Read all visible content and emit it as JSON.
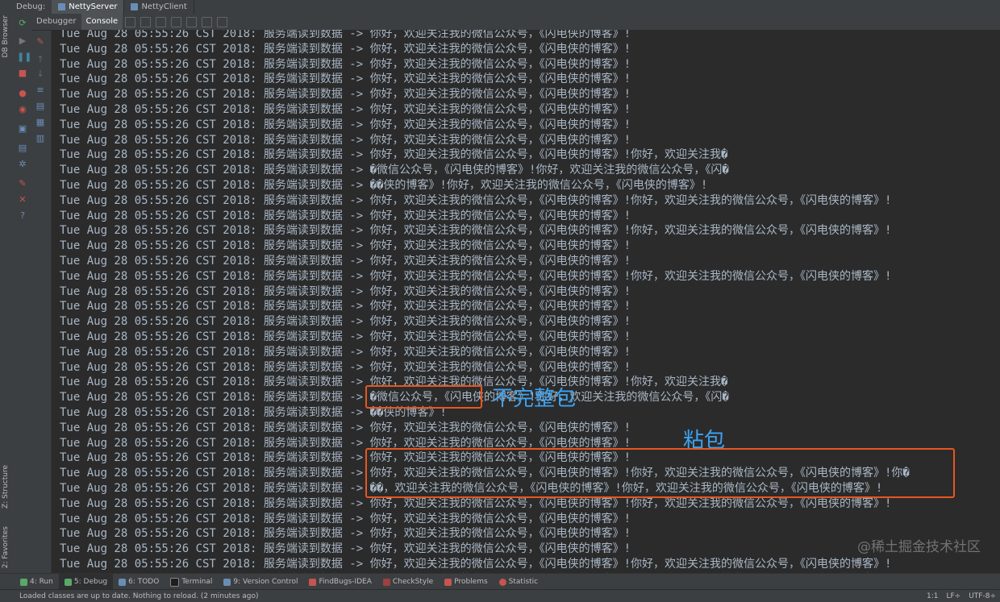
{
  "top_bar": {
    "label": "Debug:",
    "tabs": [
      {
        "label": "NettyServer",
        "active": true
      },
      {
        "label": "NettyClient",
        "active": false
      }
    ]
  },
  "left_strip": {
    "db_browser": "DB Browser",
    "structure": "Z: Structure",
    "favorites": "2: Favorites"
  },
  "sub_tabs": [
    {
      "label": "Debugger",
      "active": false
    },
    {
      "label": "Console",
      "active": true
    }
  ],
  "console": {
    "lines": [
      "Tue Aug 28 05:55:26 CST 2018: 服务端读到数据 -> 你好，欢迎关注我的微信公众号，《闪电侠的博客》!",
      "Tue Aug 28 05:55:26 CST 2018: 服务端读到数据 -> 你好，欢迎关注我的微信公众号，《闪电侠的博客》!",
      "Tue Aug 28 05:55:26 CST 2018: 服务端读到数据 -> 你好，欢迎关注我的微信公众号，《闪电侠的博客》!",
      "Tue Aug 28 05:55:26 CST 2018: 服务端读到数据 -> 你好，欢迎关注我的微信公众号，《闪电侠的博客》!",
      "Tue Aug 28 05:55:26 CST 2018: 服务端读到数据 -> 你好，欢迎关注我的微信公众号，《闪电侠的博客》!",
      "Tue Aug 28 05:55:26 CST 2018: 服务端读到数据 -> 你好，欢迎关注我的微信公众号，《闪电侠的博客》!",
      "Tue Aug 28 05:55:26 CST 2018: 服务端读到数据 -> 你好，欢迎关注我的微信公众号，《闪电侠的博客》!",
      "Tue Aug 28 05:55:26 CST 2018: 服务端读到数据 -> 你好，欢迎关注我的微信公众号，《闪电侠的博客》!",
      "Tue Aug 28 05:55:26 CST 2018: 服务端读到数据 -> 你好，欢迎关注我的微信公众号，《闪电侠的博客》!你好，欢迎关注我�",
      "Tue Aug 28 05:55:26 CST 2018: 服务端读到数据 -> �微信公众号，《闪电侠的博客》!你好，欢迎关注我的微信公众号，《闪�",
      "Tue Aug 28 05:55:26 CST 2018: 服务端读到数据 -> ��侠的博客》!你好，欢迎关注我的微信公众号，《闪电侠的博客》!",
      "Tue Aug 28 05:55:26 CST 2018: 服务端读到数据 -> 你好，欢迎关注我的微信公众号，《闪电侠的博客》!你好，欢迎关注我的微信公众号，《闪电侠的博客》!",
      "Tue Aug 28 05:55:26 CST 2018: 服务端读到数据 -> 你好，欢迎关注我的微信公众号，《闪电侠的博客》!",
      "Tue Aug 28 05:55:26 CST 2018: 服务端读到数据 -> 你好，欢迎关注我的微信公众号，《闪电侠的博客》!你好，欢迎关注我的微信公众号，《闪电侠的博客》!",
      "Tue Aug 28 05:55:26 CST 2018: 服务端读到数据 -> 你好，欢迎关注我的微信公众号，《闪电侠的博客》!",
      "Tue Aug 28 05:55:26 CST 2018: 服务端读到数据 -> 你好，欢迎关注我的微信公众号，《闪电侠的博客》!",
      "Tue Aug 28 05:55:26 CST 2018: 服务端读到数据 -> 你好，欢迎关注我的微信公众号，《闪电侠的博客》!你好，欢迎关注我的微信公众号，《闪电侠的博客》!",
      "Tue Aug 28 05:55:26 CST 2018: 服务端读到数据 -> 你好，欢迎关注我的微信公众号，《闪电侠的博客》!",
      "Tue Aug 28 05:55:26 CST 2018: 服务端读到数据 -> 你好，欢迎关注我的微信公众号，《闪电侠的博客》!",
      "Tue Aug 28 05:55:26 CST 2018: 服务端读到数据 -> 你好，欢迎关注我的微信公众号，《闪电侠的博客》!",
      "Tue Aug 28 05:55:26 CST 2018: 服务端读到数据 -> 你好，欢迎关注我的微信公众号，《闪电侠的博客》!",
      "Tue Aug 28 05:55:26 CST 2018: 服务端读到数据 -> 你好，欢迎关注我的微信公众号，《闪电侠的博客》!",
      "Tue Aug 28 05:55:26 CST 2018: 服务端读到数据 -> 你好，欢迎关注我的微信公众号，《闪电侠的博客》!",
      "Tue Aug 28 05:55:26 CST 2018: 服务端读到数据 -> 你好，欢迎关注我的微信公众号，《闪电侠的博客》!你好，欢迎关注我�",
      "Tue Aug 28 05:55:26 CST 2018: 服务端读到数据 -> �微信公众号，《闪电侠的博客》!你好，欢迎关注我的微信公众号，《闪�",
      "Tue Aug 28 05:55:26 CST 2018: 服务端读到数据 -> ��侠的博客》!",
      "Tue Aug 28 05:55:26 CST 2018: 服务端读到数据 -> 你好，欢迎关注我的微信公众号，《闪电侠的博客》!",
      "Tue Aug 28 05:55:26 CST 2018: 服务端读到数据 -> 你好，欢迎关注我的微信公众号，《闪电侠的博客》!",
      "Tue Aug 28 05:55:26 CST 2018: 服务端读到数据 -> 你好，欢迎关注我的微信公众号，《闪电侠的博客》!",
      "Tue Aug 28 05:55:26 CST 2018: 服务端读到数据 -> 你好，欢迎关注我的微信公众号，《闪电侠的博客》!你好，欢迎关注我的微信公众号，《闪电侠的博客》!你�",
      "Tue Aug 28 05:55:26 CST 2018: 服务端读到数据 -> ��，欢迎关注我的微信公众号，《闪电侠的博客》!你好，欢迎关注我的微信公众号，《闪电侠的博客》!",
      "Tue Aug 28 05:55:26 CST 2018: 服务端读到数据 -> 你好，欢迎关注我的微信公众号，《闪电侠的博客》!你好，欢迎关注我的微信公众号，《闪电侠的博客》!",
      "Tue Aug 28 05:55:26 CST 2018: 服务端读到数据 -> 你好，欢迎关注我的微信公众号，《闪电侠的博客》!",
      "Tue Aug 28 05:55:26 CST 2018: 服务端读到数据 -> 你好，欢迎关注我的微信公众号，《闪电侠的博客》!",
      "Tue Aug 28 05:55:26 CST 2018: 服务端读到数据 -> 你好，欢迎关注我的微信公众号，《闪电侠的博客》!",
      "Tue Aug 28 05:55:26 CST 2018: 服务端读到数据 -> 你好，欢迎关注我的微信公众号，《闪电侠的博客》!你好，欢迎关注我的微信公众号，《闪电侠的博客》!",
      "Tue Aug 28 05:55:26 CST 2018: 服务端读到数据 -> 你好，欢迎关注我的微信公众号，《闪电侠的博客》!你好，欢迎关注我的微信公众号，《闪电侠的博客》!",
      "Tue Aug 28 05:55:26 CST 2018: 服务端读到数据 -> 你好，欢迎关注我的微信公众号，《闪电侠的博客》!"
    ]
  },
  "annotations": {
    "incomplete_label": "不完整包",
    "sticky_label": "粘包",
    "accent_color": "#3da3f0",
    "box_color": "#e8561f"
  },
  "watermark": "@稀土掘金技术社区",
  "bottom_tools": [
    {
      "label": "4: Run",
      "icon": "run-icon"
    },
    {
      "label": "5: Debug",
      "icon": "debug-icon",
      "active": true
    },
    {
      "label": "6: TODO",
      "icon": "todo-icon"
    },
    {
      "label": "Terminal",
      "icon": "terminal-icon"
    },
    {
      "label": "9: Version Control",
      "icon": "vcs-icon"
    },
    {
      "label": "FindBugs-IDEA",
      "icon": "findbugs-icon"
    },
    {
      "label": "CheckStyle",
      "icon": "checkstyle-icon"
    },
    {
      "label": "Problems",
      "icon": "problems-icon"
    },
    {
      "label": "Statistic",
      "icon": "statistic-icon"
    }
  ],
  "status_bar": {
    "message": "Loaded classes are up to date. Nothing to reload. (2 minutes ago)",
    "position": "1:1",
    "line_sep": "LF÷",
    "encoding": "UTF-8÷"
  }
}
